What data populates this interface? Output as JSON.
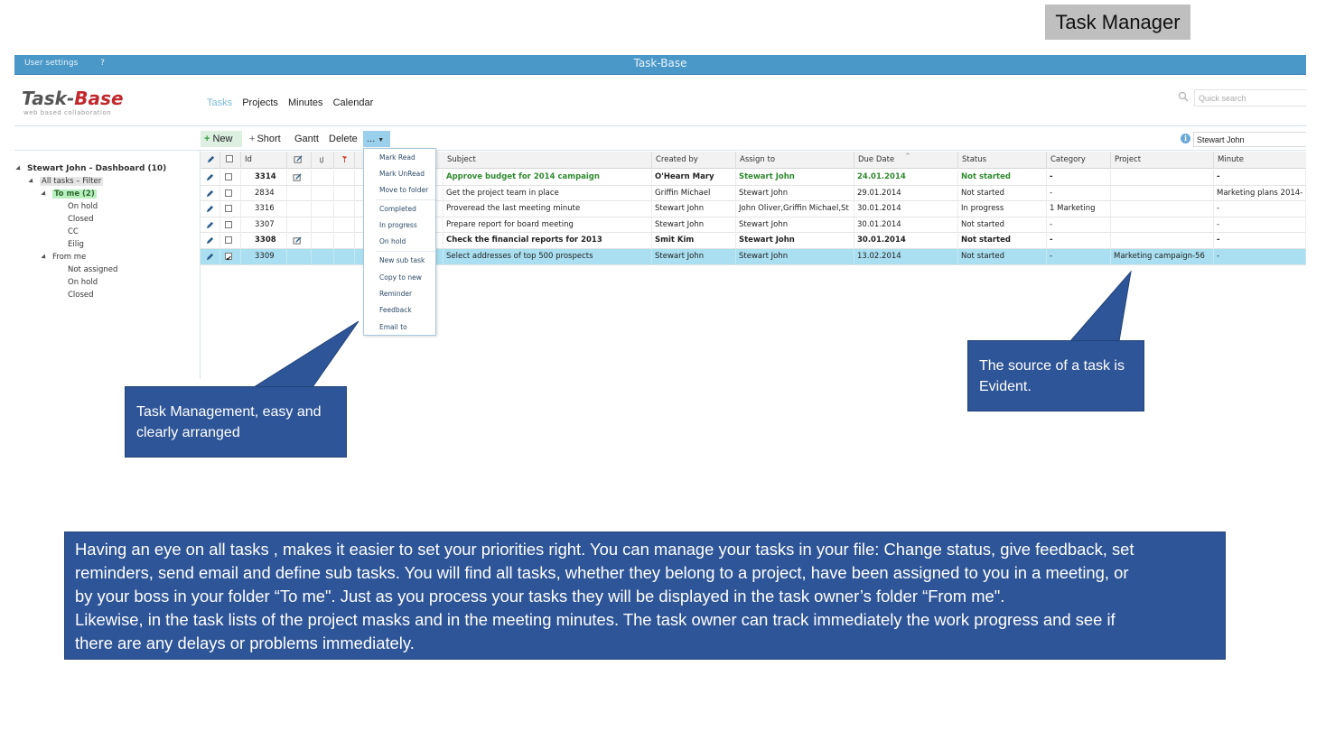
{
  "slide_title": "Task Manager",
  "app_bar": {
    "user_settings": "User settings",
    "help": "?",
    "title": "Task-Base"
  },
  "logo": {
    "part1": "Task",
    "dash": "-",
    "part2": "Base",
    "tagline": "web based collaboration"
  },
  "nav": [
    "Tasks",
    "Projects",
    "Minutes",
    "Calendar"
  ],
  "quick_search_placeholder": "Quick search",
  "toolbar": {
    "new": "New",
    "short": "Short",
    "gantt": "Gantt",
    "delete": "Delete",
    "more": "..."
  },
  "user_filter": "Stewart John",
  "tree": {
    "root": "Stewart John - Dashboard (10)",
    "all_tasks": "All tasks – Filter",
    "to_me": "To me (2)",
    "to_me_children": [
      "On hold",
      "Closed",
      "CC",
      "Eilig"
    ],
    "from_me": "From me",
    "from_me_children": [
      "Not assigned",
      "On hold",
      "Closed"
    ]
  },
  "grid": {
    "columns": [
      "Id",
      "Subject",
      "Created by",
      "Assign to",
      "Due Date",
      "Status",
      "Category",
      "Project",
      "Minute"
    ],
    "rows": [
      {
        "id": "3314",
        "note": true,
        "subject": "Approve budget for 2014 campaign",
        "created_by": "O'Hearn Mary",
        "assign_to": "Stewart John",
        "due": "24.01.2014",
        "status": "Not started",
        "category": "-",
        "project": "",
        "minute": "-",
        "checked": false
      },
      {
        "id": "2834",
        "note": false,
        "subject": "Get the project team in place",
        "created_by": "Griffin Michael",
        "assign_to": "Stewart John",
        "due": "29.01.2014",
        "status": "Not started",
        "category": "-",
        "project": "",
        "minute": "Marketing plans 2014-",
        "checked": false
      },
      {
        "id": "3316",
        "note": false,
        "subject": "Proveread the last meeting minute",
        "created_by": "Stewart John",
        "assign_to": "John Oliver,Griffin Michael,St",
        "due": "30.01.2014",
        "status": "In progress",
        "category": "1 Marketing",
        "project": "",
        "minute": "-",
        "checked": false
      },
      {
        "id": "3307",
        "note": false,
        "subject": "Prepare report for board meeting",
        "created_by": "Stewart John",
        "assign_to": "Stewart John",
        "due": "30.01.2014",
        "status": "Not started",
        "category": "-",
        "project": "",
        "minute": "-",
        "checked": false
      },
      {
        "id": "3308",
        "note": true,
        "subject": "Check the financial reports for 2013",
        "created_by": "Smit Kim",
        "assign_to": "Stewart John",
        "due": "30.01.2014",
        "status": "Not started",
        "category": "-",
        "project": "",
        "minute": "-",
        "checked": false
      },
      {
        "id": "3309",
        "note": false,
        "subject": "Select addresses of top 500 prospects",
        "created_by": "Stewart John",
        "assign_to": "Stewart John",
        "due": "13.02.2014",
        "status": "Not started",
        "category": "-",
        "project": "Marketing campaign-56",
        "minute": "-",
        "checked": true
      }
    ]
  },
  "dropdown_menu": [
    "Mark Read",
    "Mark UnRead",
    "Move to folder",
    "Completed",
    "In progress",
    "On hold",
    "New sub task",
    "Copy to new",
    "Reminder",
    "Feedback",
    "Email to"
  ],
  "callouts": {
    "task_management": "Task Management, easy and clearly arranged",
    "source": "The source of a task is Evident.",
    "description": [
      "Having an eye on all tasks , makes it easier to set your priorities right. You can manage your tasks in your file: Change status, give feedback, set",
      "reminders, send email and define sub tasks. You will find all tasks, whether they belong to a project, have been assigned to you in a meeting, or",
      "by your boss in your folder “To me\". Just as you process your tasks they will be displayed in  the task owner’s  folder “From me\".",
      "Likewise, in the task lists of the project masks and in the meeting minutes. The task owner can track immediately the work progress and see if",
      "there are any delays or problems immediately."
    ]
  },
  "colors": {
    "app_bar": "#4a98c8",
    "callout": "#2e5597",
    "logo_accent": "#c0282d",
    "selected_row": "#a9dff0"
  }
}
